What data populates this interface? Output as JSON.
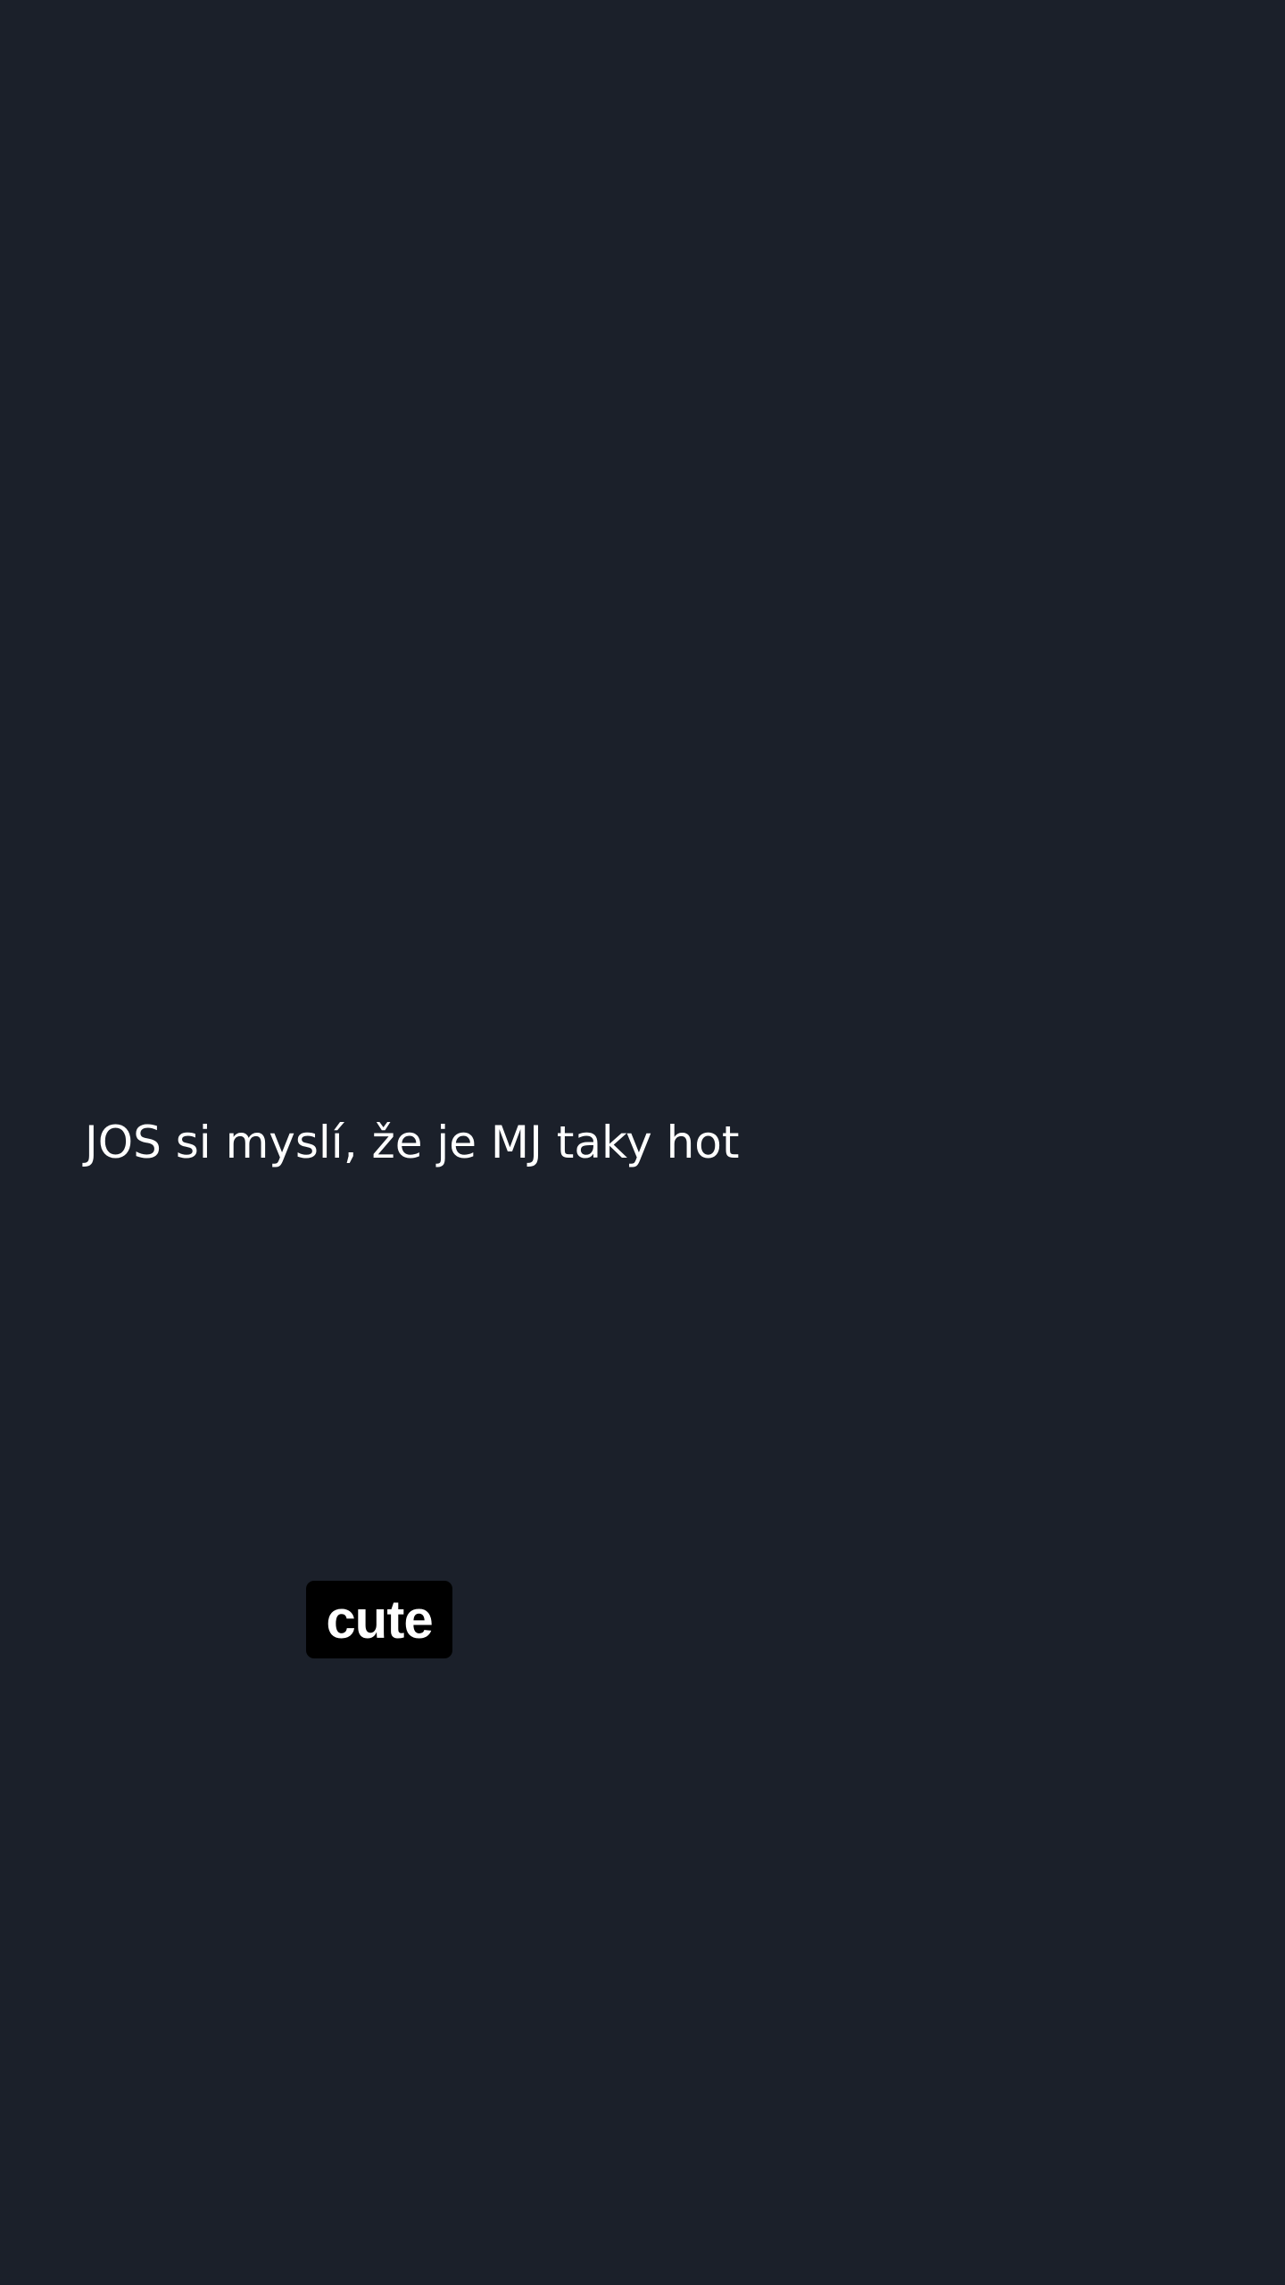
{
  "story": {
    "caption": "JOS si myslí, že je MJ taky hot",
    "sticker_text": "cute"
  },
  "colors": {
    "background": "#1b202a",
    "caption_text": "#ffffff",
    "sticker_background": "#000000",
    "sticker_text": "#ffffff"
  }
}
